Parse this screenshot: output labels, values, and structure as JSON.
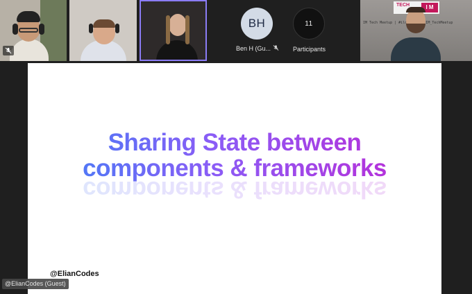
{
  "participants": [
    {
      "type": "video",
      "muted": true
    },
    {
      "type": "video",
      "muted": false
    },
    {
      "type": "video",
      "muted": false,
      "active_speaker": true
    },
    {
      "type": "avatar",
      "initials": "BH",
      "name": "Ben H (Gu...",
      "muted": true
    },
    {
      "type": "avatar",
      "initials": "11",
      "name": "Participants",
      "muted": false
    },
    {
      "type": "video",
      "muted": false
    }
  ],
  "presenter_overlay": {
    "sign_text": "I M TECH",
    "sign_sub": "Tech Meetup | #ilove... | #IM_TechMeetup"
  },
  "slide": {
    "title_line1": "Sharing State between",
    "title_line2": "components & frameworks",
    "handle": "@ElianCodes",
    "gradient": [
      "#3b82f6",
      "#8b5cf6",
      "#c026d3"
    ]
  },
  "presenter_name": "@ElianCodes (Guest)",
  "colors": {
    "bg": "#1f1f1f",
    "active_border": "#8b7cf6",
    "avatar_bg": "#d3dbe6",
    "avatar_text": "#1f2a44"
  }
}
